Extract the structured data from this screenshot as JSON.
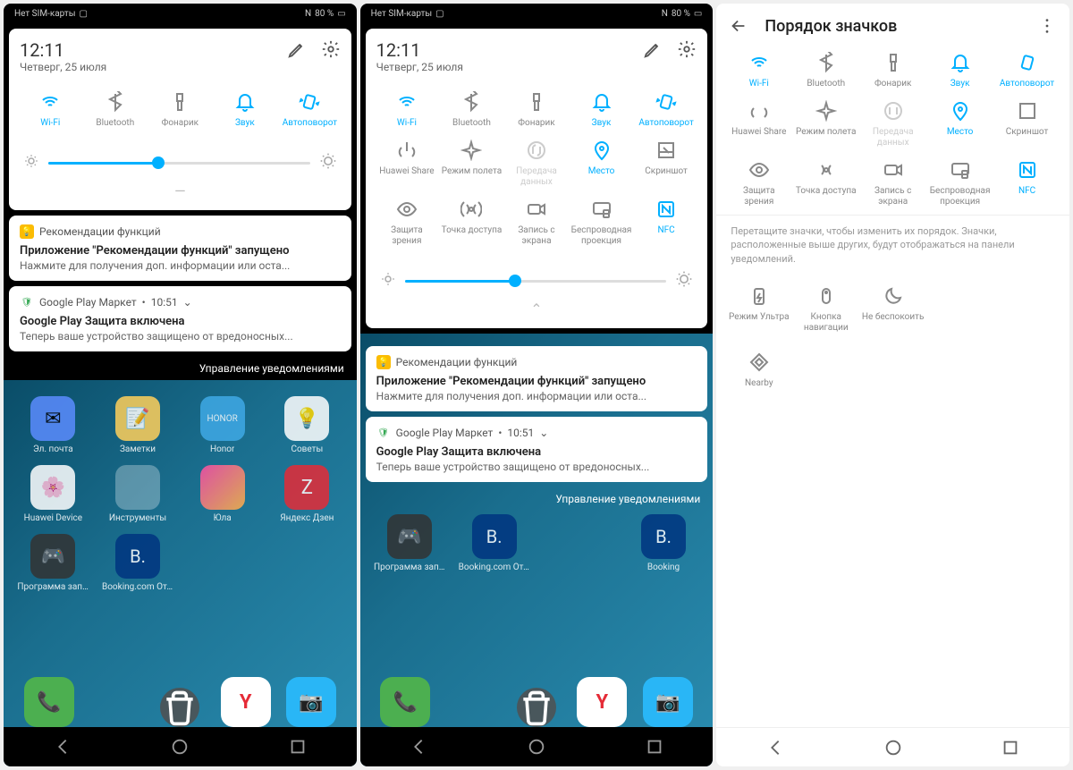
{
  "status": {
    "sim": "Нет SIM-карты",
    "battery": "80 %"
  },
  "qs": {
    "time": "12:11",
    "date": "Четверг, 25 июля"
  },
  "tiles": {
    "wifi": "Wi-Fi",
    "bluetooth": "Bluetooth",
    "flashlight": "Фонарик",
    "sound": "Звук",
    "autorotate": "Автоповорот",
    "huaweiShare": "Huawei Share",
    "airplane": "Режим полета",
    "data": "Передача данных",
    "location": "Место",
    "screenshot": "Скриншот",
    "eyeComfort": "Защита зрения",
    "hotspot": "Точка доступа",
    "screenRecord": "Запись с экрана",
    "cast": "Беспроводная проекция",
    "nfc": "NFC",
    "ultra": "Режим Ультра",
    "navButton": "Кнопка навигации",
    "dnd": "Не беспокоить",
    "nearby": "Nearby"
  },
  "notif1": {
    "app": "Рекомендации функций",
    "title": "Приложение \"Рекомендации функций\" запущено",
    "body": "Нажмите для получения доп. информации или оста..."
  },
  "notif2": {
    "app": "Google Play Маркет",
    "time": "10:51",
    "title": "Google Play Защита включена",
    "body": "Теперь ваше устройство защищено от вредоносных..."
  },
  "manage": "Управление уведомлениями",
  "apps": {
    "email": "Эл. почта",
    "notes": "Заметки",
    "honor": "Honor",
    "tips": "Советы",
    "huaweiDevice": "Huawei Device",
    "tools": "Инструменты",
    "youla": "Юла",
    "zen": "Яндекс Дзен",
    "fortnite": "Программа запуска Fort...",
    "booking": "Booking.com Отели",
    "bookingShort": "Booking"
  },
  "screen3": {
    "title": "Порядок значков",
    "hint": "Перетащите значки, чтобы изменить их порядок. Значки, расположенные выше других, будут отображаться на панели уведомлений."
  }
}
